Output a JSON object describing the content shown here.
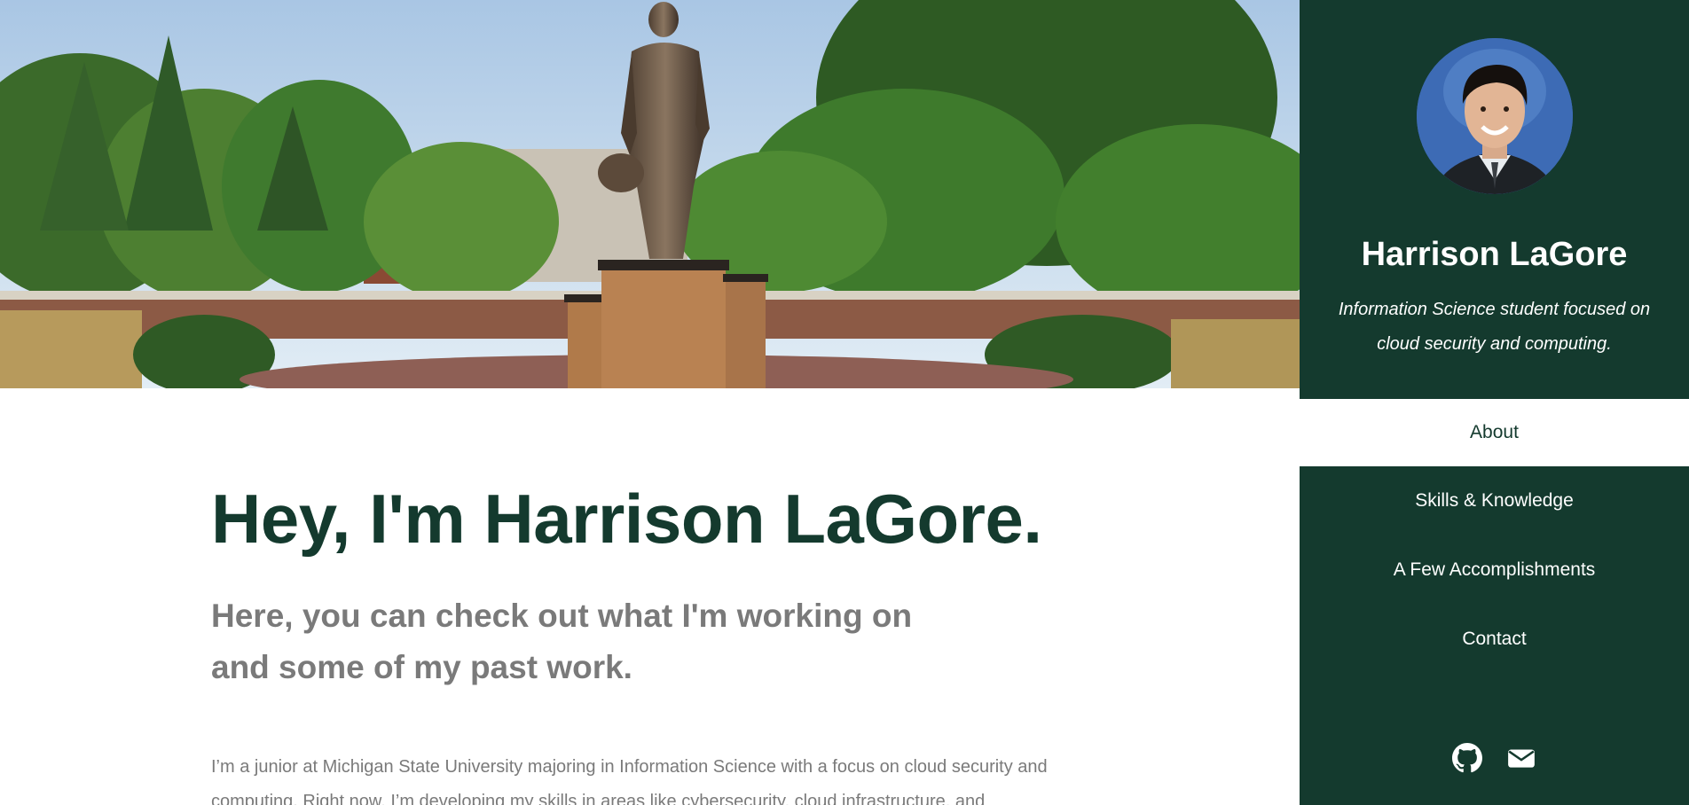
{
  "sidebar": {
    "name": "Harrison LaGore",
    "tagline": "Information Science student focused on cloud security and computing.",
    "nav": [
      {
        "label": "About",
        "active": true
      },
      {
        "label": "Skills & Knowledge",
        "active": false
      },
      {
        "label": "A Few Accomplishments",
        "active": false
      },
      {
        "label": "Contact",
        "active": false
      }
    ],
    "social_icons": [
      "github-icon",
      "envelope-icon"
    ]
  },
  "main": {
    "headline": "Hey, I'm Harrison LaGore.",
    "subhead": "Here, you can check out what I'm working on and some of my past work.",
    "intro": "I’m a junior at Michigan State University majoring in Information Science with a focus on cloud security and computing. Right now, I’m developing my skills in areas like cybersecurity, cloud infrastructure, and"
  },
  "colors": {
    "sidebar_bg": "#143a2e",
    "headline": "#143a2e",
    "body_text": "#7a7a7a"
  }
}
